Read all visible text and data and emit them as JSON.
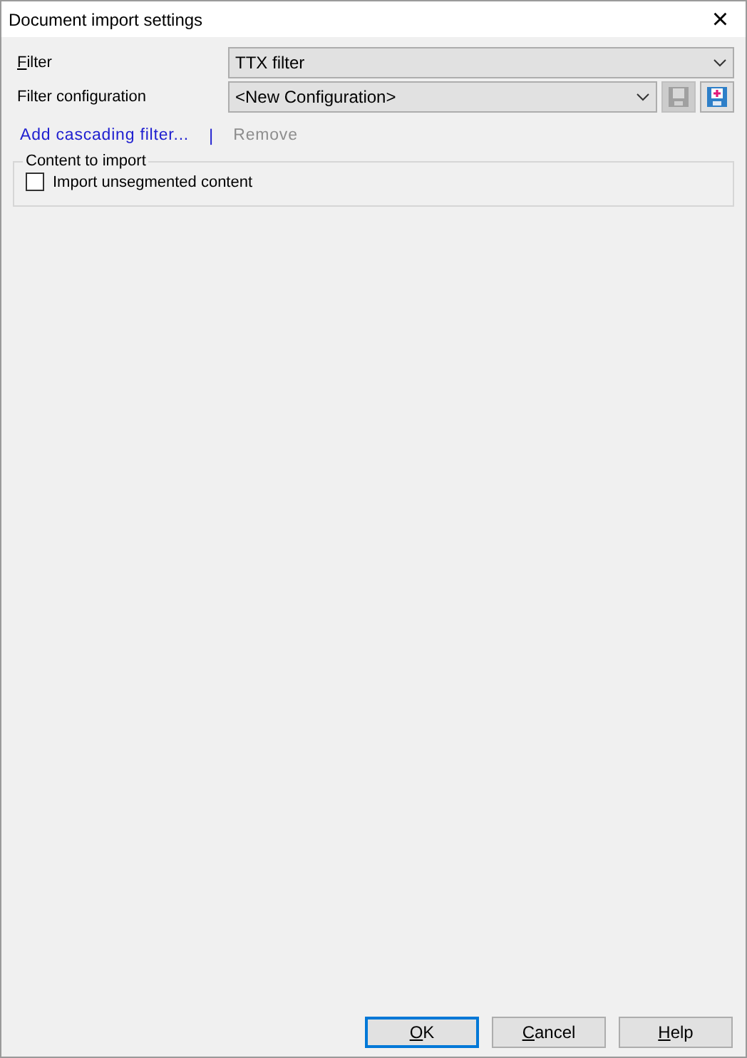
{
  "window": {
    "title": "Document import settings",
    "close": "×"
  },
  "filter": {
    "label": "Filter",
    "underline_first": true,
    "value": "TTX filter"
  },
  "filter_configuration": {
    "label": "Filter configuration",
    "underline_first": false,
    "value": "<New Configuration>",
    "save_disabled": true,
    "add_disabled": false
  },
  "links": [
    {
      "label": "Add cascading filter...",
      "disabled": false
    },
    {
      "label": "Remove",
      "disabled": true
    }
  ],
  "link_separator": "|",
  "group": {
    "title": "Content to import",
    "options": [
      {
        "label": "Import unsegmented content",
        "checked": false
      }
    ]
  },
  "buttons": [
    {
      "label": "OK",
      "underline_first": true,
      "default": true
    },
    {
      "label": "Cancel",
      "underline_first": true,
      "default": false
    },
    {
      "label": "Help",
      "underline_first": true,
      "default": false
    }
  ]
}
